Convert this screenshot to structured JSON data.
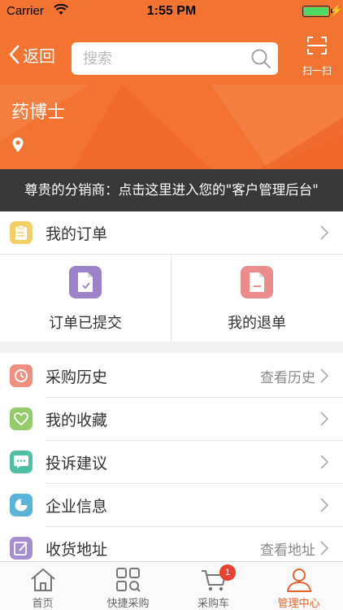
{
  "status_bar": {
    "carrier": "Carrier",
    "time": "1:55 PM"
  },
  "nav": {
    "back_label": "返回",
    "search_placeholder": "搜索",
    "scan_label": "扫一扫"
  },
  "banner": {
    "title": "药博士"
  },
  "notice": {
    "text": "尊贵的分销商：点击这里进入您的\"客户管理后台\""
  },
  "orders": {
    "header_label": "我的订单",
    "items": [
      {
        "label": "订单已提交",
        "icon": "document-check-icon",
        "color": "#9b82c9"
      },
      {
        "label": "我的退单",
        "icon": "document-return-icon",
        "color": "#ee8c8c"
      }
    ]
  },
  "menu": {
    "items": [
      {
        "label": "采购历史",
        "right_text": "查看历史",
        "icon": "history-icon",
        "color": "#ef8f7e"
      },
      {
        "label": "我的收藏",
        "right_text": "",
        "icon": "heart-icon",
        "color": "#93cc6a"
      },
      {
        "label": "投诉建议",
        "right_text": "",
        "icon": "message-icon",
        "color": "#4fbfa6"
      },
      {
        "label": "企业信息",
        "right_text": "",
        "icon": "pie-chart-icon",
        "color": "#5ab3d8"
      },
      {
        "label": "收货地址",
        "right_text": "查看地址",
        "icon": "edit-address-icon",
        "color": "#a58fd0"
      }
    ]
  },
  "tab_bar": {
    "tabs": [
      {
        "label": "首页",
        "icon": "home-icon"
      },
      {
        "label": "快捷采购",
        "icon": "quick-purchase-icon"
      },
      {
        "label": "采购车",
        "icon": "cart-icon",
        "badge": "1"
      },
      {
        "label": "管理中心",
        "icon": "user-icon"
      }
    ],
    "active_color": "#e8622a"
  },
  "colors": {
    "brand": "#f37431",
    "notice_bg": "#383838"
  }
}
